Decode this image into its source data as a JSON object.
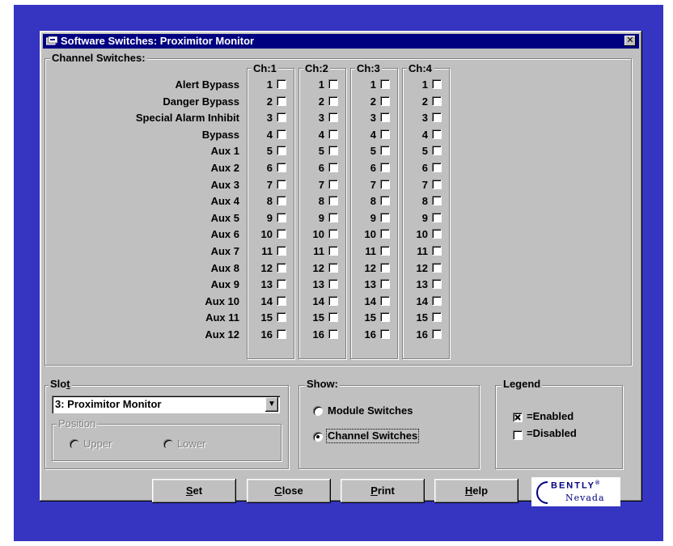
{
  "window": {
    "title": "Software Switches: Proximitor Monitor",
    "close_glyph": "✕"
  },
  "channel_switches": {
    "label": "Channel Switches:",
    "rows": [
      "Alert Bypass",
      "Danger Bypass",
      "Special Alarm Inhibit",
      "Bypass",
      "Aux 1",
      "Aux 2",
      "Aux 3",
      "Aux 4",
      "Aux 5",
      "Aux 6",
      "Aux 7",
      "Aux 8",
      "Aux 9",
      "Aux 10",
      "Aux 11",
      "Aux 12"
    ],
    "channels": [
      "Ch:1",
      "Ch:2",
      "Ch:3",
      "Ch:4"
    ],
    "numbers": [
      "1",
      "2",
      "3",
      "4",
      "5",
      "6",
      "7",
      "8",
      "9",
      "10",
      "11",
      "12",
      "13",
      "14",
      "15",
      "16"
    ]
  },
  "slot": {
    "label_pre": "Slo",
    "label_ul": "t",
    "selected": "3: Proximitor Monitor",
    "position": {
      "label": "Position",
      "upper": "Upper",
      "lower": "Lower"
    }
  },
  "show": {
    "label": "Show:",
    "module": "Module Switches",
    "channel": "Channel Switches",
    "selected": "channel"
  },
  "legend": {
    "label": "Legend",
    "enabled": "=Enabled",
    "disabled": "=Disabled"
  },
  "buttons": {
    "set": {
      "ul": "S",
      "rest": "et"
    },
    "close": {
      "ul": "C",
      "rest": "lose"
    },
    "print": {
      "ul": "P",
      "rest": "rint"
    },
    "help": {
      "ul": "H",
      "rest": "elp"
    }
  },
  "logo": {
    "brand": "BENTLY",
    "sub": "Nevada",
    "reg": "®"
  },
  "colors": {
    "desktop": "#3535c2",
    "titlebar": "#000080",
    "face": "#c0c0c0"
  }
}
